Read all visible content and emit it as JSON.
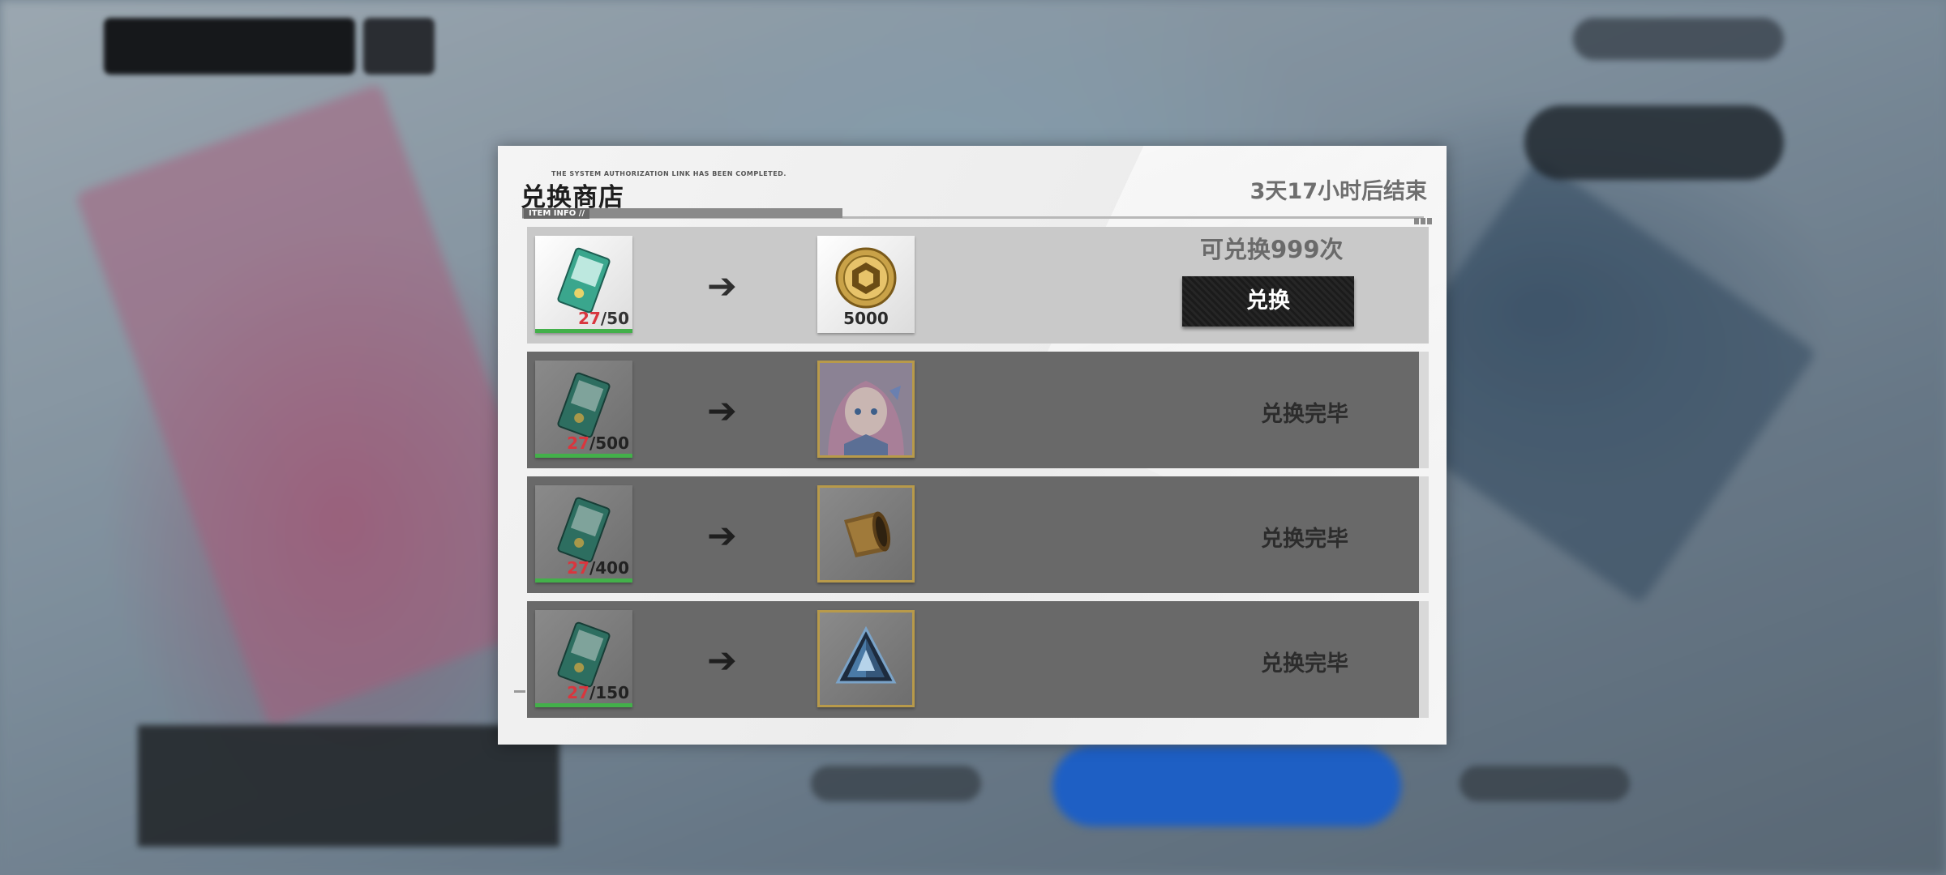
{
  "dialog": {
    "tagline": "THE SYSTEM AUTHORIZATION LINK HAS BEEN COMPLETED.",
    "title": "兑换商店",
    "subtag": "ITEM INFO //",
    "countdown": "3天17小时后结束"
  },
  "rows": [
    {
      "source_icon": "ticket-icon",
      "have": "27",
      "need": "/50",
      "reward_icon": "gold-coin-icon",
      "reward_qty": "5000",
      "remaining": "可兑换999次",
      "button_label": "兑换",
      "status": ""
    },
    {
      "source_icon": "ticket-icon",
      "have": "27",
      "need": "/500",
      "reward_icon": "character-portrait-icon",
      "reward_qty": "",
      "status": "兑换完毕"
    },
    {
      "source_icon": "ticket-icon",
      "have": "27",
      "need": "/400",
      "reward_icon": "bronze-horn-icon",
      "reward_qty": "",
      "status": "兑换完毕"
    },
    {
      "source_icon": "ticket-icon",
      "have": "27",
      "need": "/150",
      "reward_icon": "crystal-prism-icon",
      "reward_qty": "",
      "status": "兑换完毕"
    }
  ],
  "colors": {
    "have_count": "#d9363e",
    "progress_bar": "#43b04a",
    "done_row": "#696969",
    "active_row": "#c9c9c9"
  }
}
